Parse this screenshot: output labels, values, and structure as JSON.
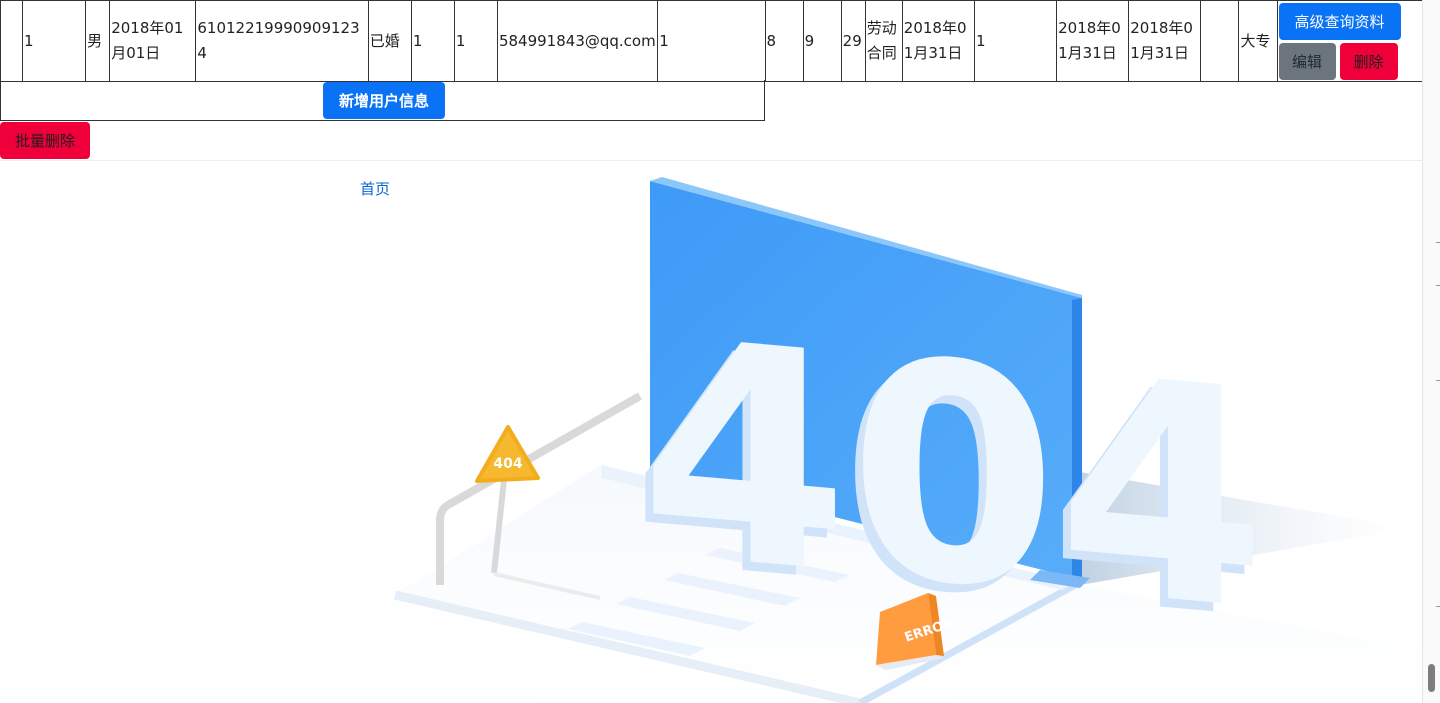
{
  "table": {
    "row": [
      "",
      "1",
      "男",
      "2018年01月01日",
      "610122199909091234",
      "已婚",
      "1",
      "1",
      "584991843@qq.com",
      "1",
      "",
      "8",
      "9",
      "29",
      "劳动合同",
      "2018年01月31日",
      "1",
      "",
      "2018年01月31日",
      "2018年01月31日",
      "",
      "大专"
    ],
    "actions": {
      "advanced_query": "高级查询资料",
      "edit": "编辑",
      "delete": "删除"
    }
  },
  "add_button": "新增用户信息",
  "batch_delete_button": "批量删除",
  "home_link": "首页",
  "illustration": {
    "big_number": "404",
    "sign_text": "404",
    "board_text": "ERROR"
  },
  "colors": {
    "primary": "#0a73f5",
    "secondary": "#6c757d",
    "danger": "#f0003a",
    "illustration_blue": "#3d9bf7",
    "sign_yellow": "#f5b82e",
    "board_orange": "#ff9c40"
  }
}
